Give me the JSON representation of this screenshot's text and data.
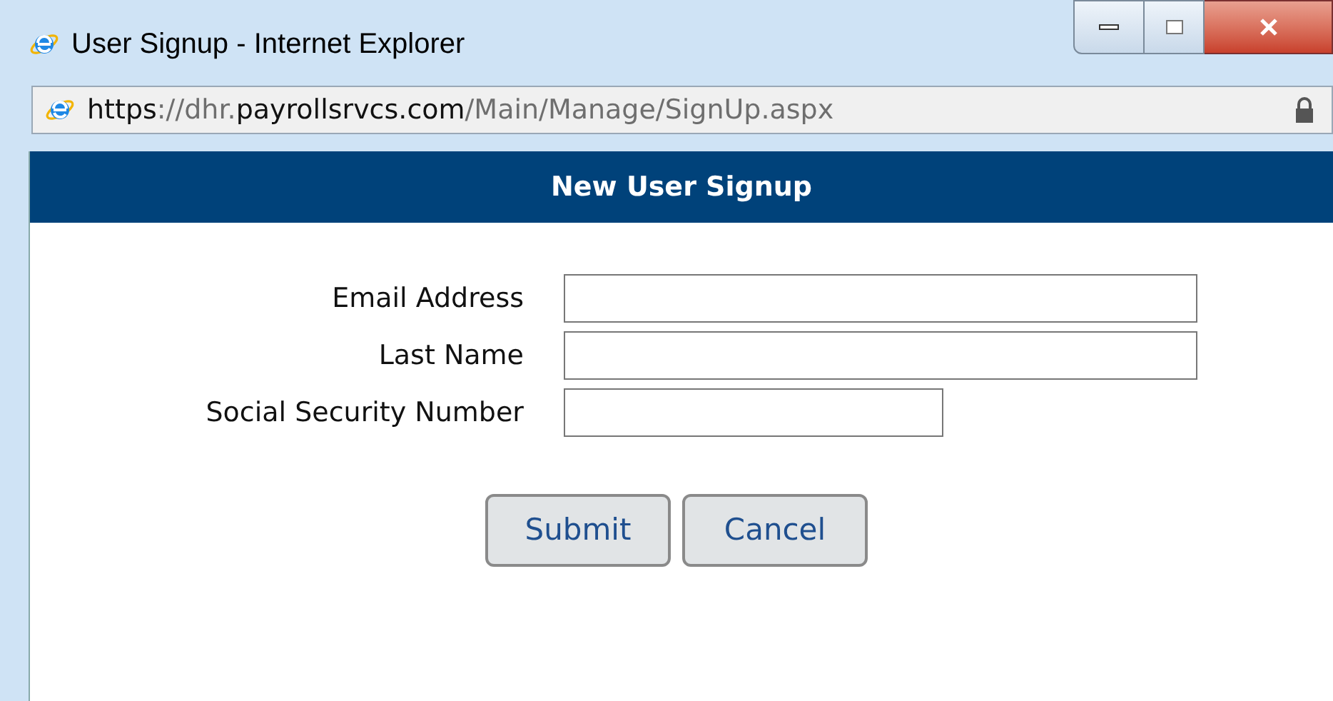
{
  "window": {
    "title": "User Signup - Internet Explorer"
  },
  "address_bar": {
    "url": [
      {
        "text": "https",
        "emphasis": true
      },
      {
        "text": "://dhr.",
        "emphasis": false
      },
      {
        "text": "payrollsrvcs.com",
        "emphasis": true
      },
      {
        "text": "/Main/Manage/SignUp.aspx",
        "emphasis": false
      }
    ]
  },
  "header": {
    "title": "New User Signup"
  },
  "fields": [
    {
      "label": "Email Address",
      "kind": "wide"
    },
    {
      "label": "Last Name",
      "kind": "wide"
    },
    {
      "label": "Social Security Number",
      "kind": "short"
    }
  ],
  "buttons": [
    "Submit",
    "Cancel"
  ]
}
